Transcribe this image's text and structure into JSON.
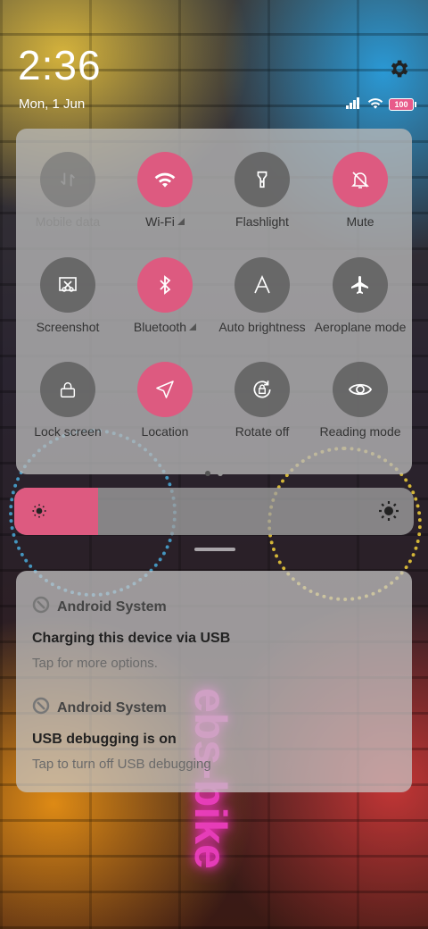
{
  "status": {
    "time": "2:36",
    "date": "Mon, 1 Jun",
    "battery": "100",
    "icons": [
      "signal-icon",
      "wifi-icon",
      "battery-icon"
    ]
  },
  "settings_icon": "gear-icon",
  "quick_settings": {
    "tiles": [
      {
        "label": "Mobile data",
        "state": "disabled",
        "icon": "mobile-data-icon"
      },
      {
        "label": "Wi-Fi",
        "state": "on",
        "icon": "wifi-icon",
        "has_menu": true
      },
      {
        "label": "Flashlight",
        "state": "off",
        "icon": "flashlight-icon"
      },
      {
        "label": "Mute",
        "state": "on",
        "icon": "bell-off-icon"
      },
      {
        "label": "Screenshot",
        "state": "off",
        "icon": "screenshot-icon"
      },
      {
        "label": "Bluetooth",
        "state": "on",
        "icon": "bluetooth-icon",
        "has_menu": true
      },
      {
        "label": "Auto brightness",
        "state": "off",
        "icon": "auto-brightness-icon"
      },
      {
        "label": "Aeroplane mode",
        "state": "off",
        "icon": "airplane-icon"
      },
      {
        "label": "Lock screen",
        "state": "off",
        "icon": "lock-icon"
      },
      {
        "label": "Location",
        "state": "on",
        "icon": "location-icon"
      },
      {
        "label": "Rotate off",
        "state": "off",
        "icon": "rotate-lock-icon"
      },
      {
        "label": "Reading mode",
        "state": "off",
        "icon": "eye-icon"
      }
    ],
    "pages": 2,
    "current_page": 1
  },
  "brightness": {
    "level": 0.21
  },
  "notifications": [
    {
      "app": "Android System",
      "title": "Charging this device via USB",
      "text": "Tap for more options."
    },
    {
      "app": "Android System",
      "title": "USB debugging is on",
      "text": "Tap to turn off USB debugging"
    }
  ],
  "colors": {
    "accent": "#dd5a80"
  }
}
